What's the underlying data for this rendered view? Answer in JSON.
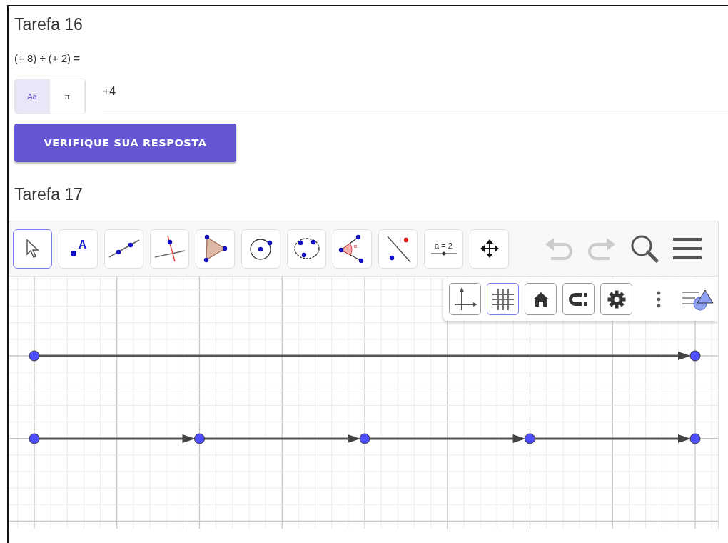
{
  "tasks": [
    {
      "kind": "question",
      "title": "Tarefa 16",
      "question": "(+ 8) ÷ (+ 2) =",
      "input_modes": [
        {
          "label": "Aa",
          "selected": true
        },
        {
          "label": "π",
          "selected": false
        }
      ],
      "answer": "+4",
      "button": "VERIFIQUE SUA RESPOSTA"
    },
    {
      "kind": "applet",
      "title": "Tarefa 17",
      "tools": [
        {
          "kind": "move",
          "selected": true
        },
        {
          "kind": "point",
          "label": "A",
          "selected": false
        },
        {
          "kind": "line",
          "selected": false
        },
        {
          "kind": "perpendicular",
          "selected": false
        },
        {
          "kind": "polygon",
          "selected": false
        },
        {
          "kind": "circle",
          "selected": false
        },
        {
          "kind": "conic",
          "selected": false
        },
        {
          "kind": "angle",
          "label": "α",
          "selected": false
        },
        {
          "kind": "reflect",
          "selected": false
        },
        {
          "kind": "slider",
          "label": "a = 2",
          "selected": false
        },
        {
          "kind": "pan",
          "selected": false
        }
      ],
      "actions": [
        {
          "kind": "undo"
        },
        {
          "kind": "redo"
        },
        {
          "kind": "search"
        },
        {
          "kind": "menu"
        }
      ],
      "style_bar": [
        {
          "kind": "axes",
          "selected": false
        },
        {
          "kind": "grid",
          "selected": true
        },
        {
          "kind": "home"
        },
        {
          "kind": "magnet"
        },
        {
          "kind": "settings"
        },
        {
          "kind": "more"
        },
        {
          "kind": "style"
        }
      ]
    }
  ]
}
